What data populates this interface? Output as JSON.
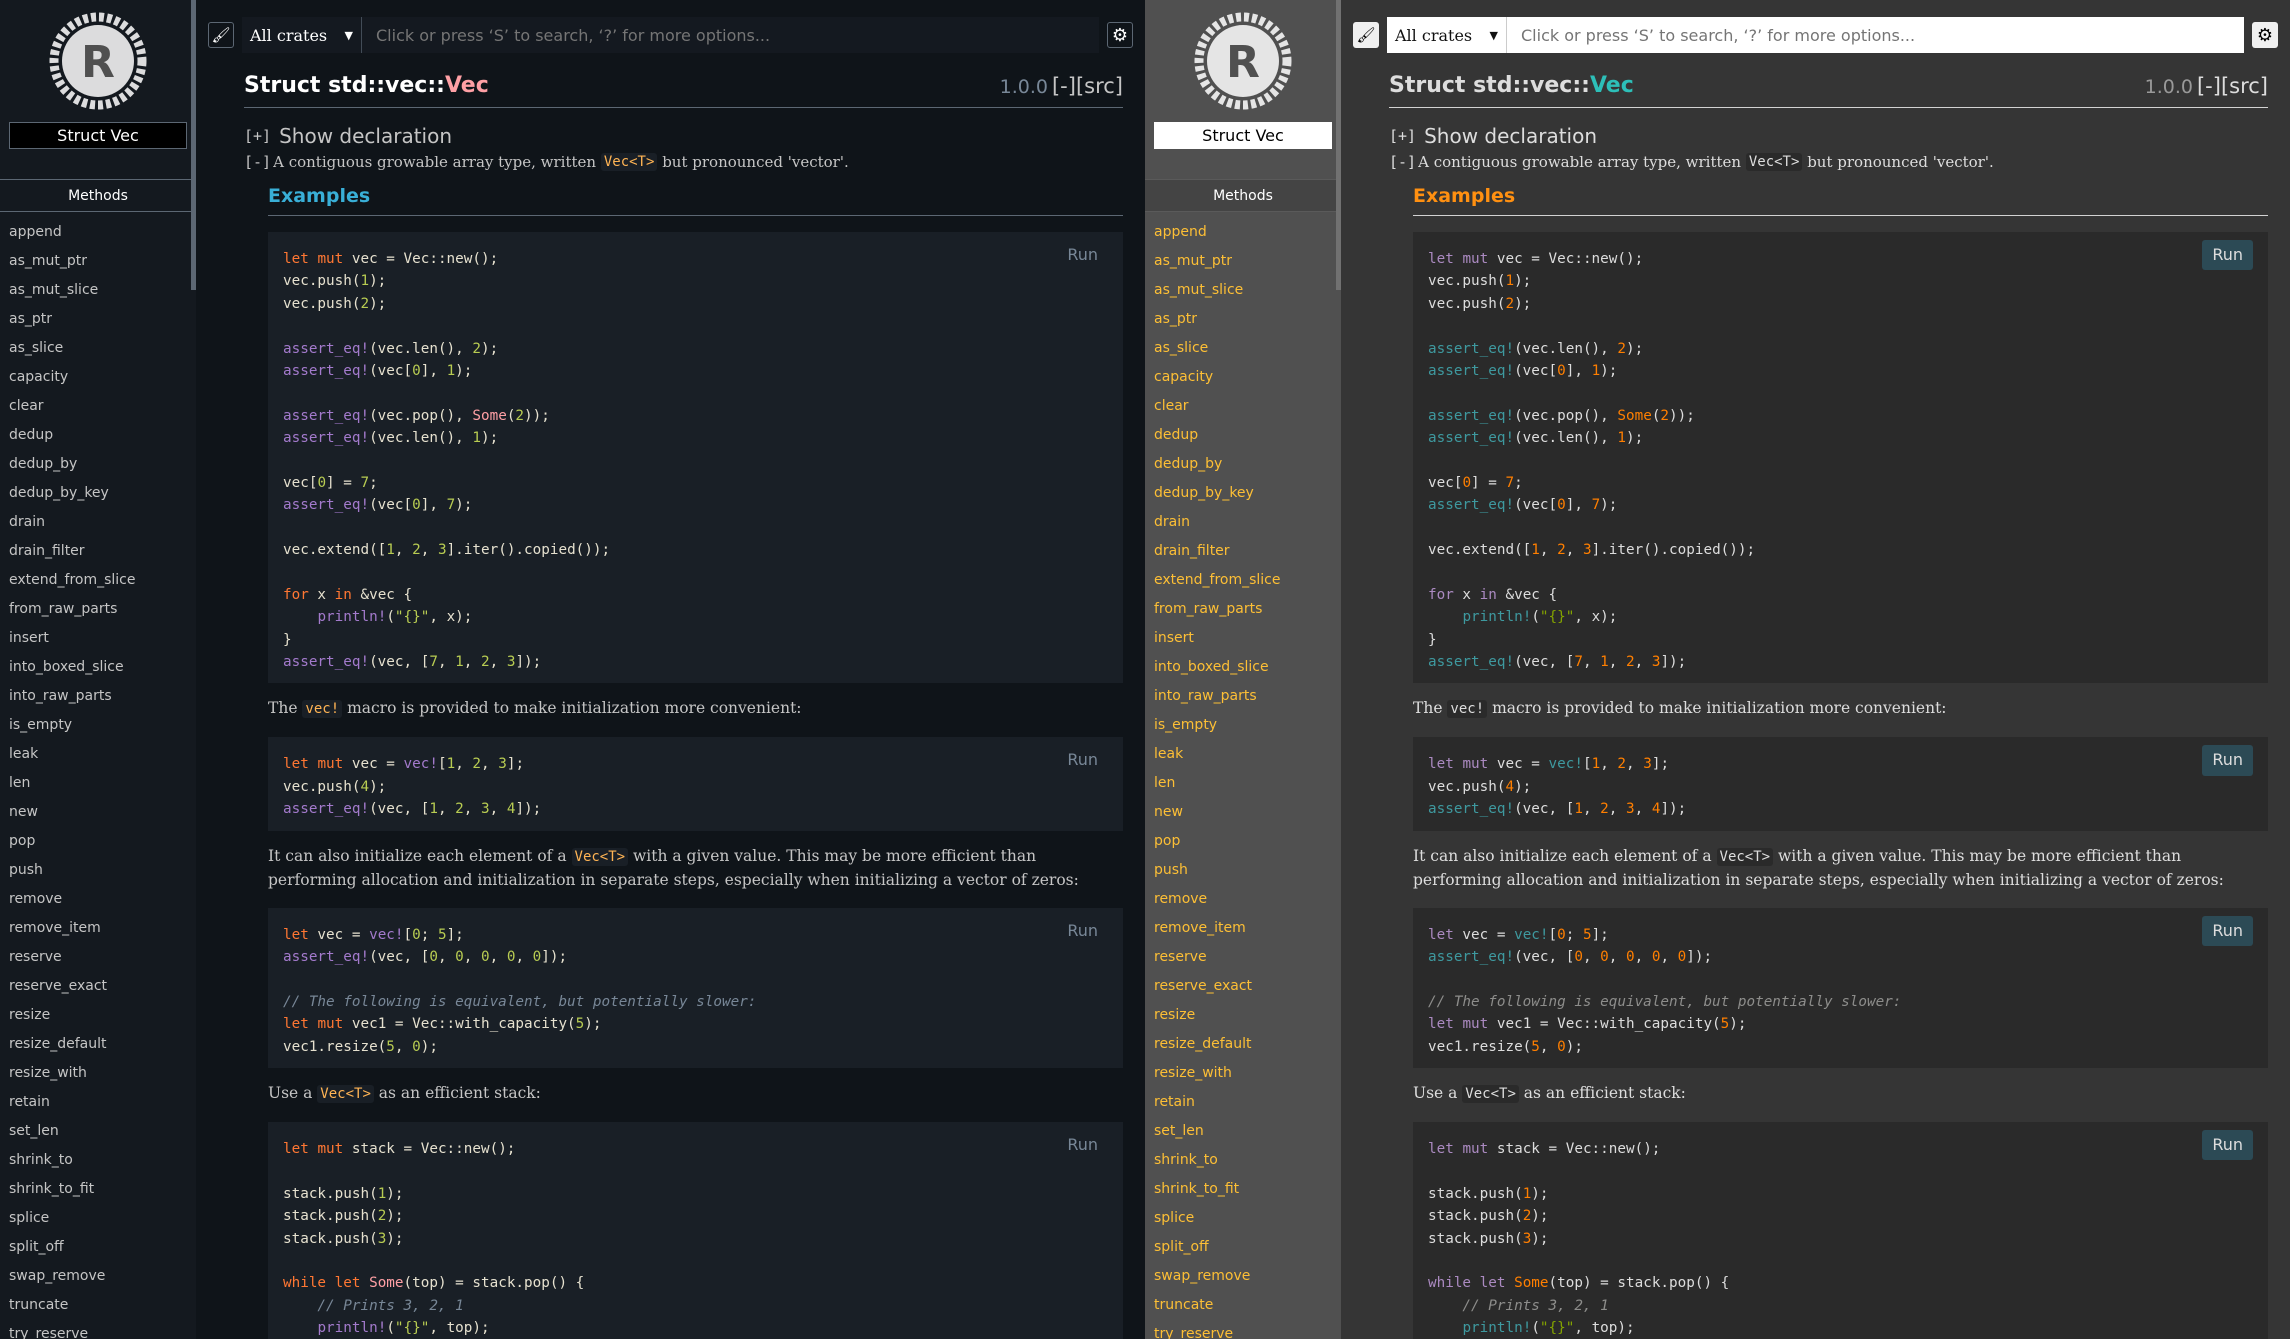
{
  "sidebar": {
    "struct_name": "Struct Vec",
    "methods_title": "Methods",
    "methods": [
      "append",
      "as_mut_ptr",
      "as_mut_slice",
      "as_ptr",
      "as_slice",
      "capacity",
      "clear",
      "dedup",
      "dedup_by",
      "dedup_by_key",
      "drain",
      "drain_filter",
      "extend_from_slice",
      "from_raw_parts",
      "insert",
      "into_boxed_slice",
      "into_raw_parts",
      "is_empty",
      "leak",
      "len",
      "new",
      "pop",
      "push",
      "remove",
      "remove_item",
      "reserve",
      "reserve_exact",
      "resize",
      "resize_default",
      "resize_with",
      "retain",
      "set_len",
      "shrink_to",
      "shrink_to_fit",
      "splice",
      "split_off",
      "swap_remove",
      "truncate",
      "try_reserve"
    ]
  },
  "topbar": {
    "theme_icon": "paintbrush-icon",
    "crate_select": "All crates",
    "search_placeholder": "Click or press ‘S’ to search, ‘?’ for more options...",
    "settings_icon": "gear-icon"
  },
  "header": {
    "title_prefix": "Struct std::vec::",
    "title_name": "Vec",
    "version": "1.0.0",
    "collapse": "[-]",
    "src": "[src]"
  },
  "declaration": {
    "toggle": "[+]",
    "label": "Show declaration"
  },
  "summary": {
    "toggle": "[-]",
    "before": "A contiguous growable array type, written ",
    "code": "Vec<T>",
    "after": " but pronounced 'vector'."
  },
  "examples_heading": "Examples",
  "run_label": "Run",
  "paragraphs": {
    "p1_before": "The ",
    "p1_code": "vec!",
    "p1_after": " macro is provided to make initialization more convenient:",
    "p2_before": "It can also initialize each element of a ",
    "p2_code": "Vec<T>",
    "p2_after": " with a given value. This may be more efficient than performing allocation and initialization in separate steps, especially when initializing a vector of zeros:",
    "p3_before": "Use a ",
    "p3_code": "Vec<T>",
    "p3_after": " as an efficient stack:"
  },
  "code_blocks": [
    [
      "let mut vec = Vec::new();",
      "vec.push(1);",
      "vec.push(2);",
      "",
      "assert_eq!(vec.len(), 2);",
      "assert_eq!(vec[0], 1);",
      "",
      "assert_eq!(vec.pop(), Some(2));",
      "assert_eq!(vec.len(), 1);",
      "",
      "vec[0] = 7;",
      "assert_eq!(vec[0], 7);",
      "",
      "vec.extend([1, 2, 3].iter().copied());",
      "",
      "for x in &vec {",
      "    println!(\"{}\", x);",
      "}",
      "assert_eq!(vec, [7, 1, 2, 3]);"
    ],
    [
      "let mut vec = vec![1, 2, 3];",
      "vec.push(4);",
      "assert_eq!(vec, [1, 2, 3, 4]);"
    ],
    [
      "let vec = vec![0; 5];",
      "assert_eq!(vec, [0, 0, 0, 0, 0]);",
      "",
      "// The following is equivalent, but potentially slower:",
      "let mut vec1 = Vec::with_capacity(5);",
      "vec1.resize(5, 0);"
    ],
    [
      "let mut stack = Vec::new();",
      "",
      "stack.push(1);",
      "stack.push(2);",
      "stack.push(3);",
      "",
      "while let Some(top) = stack.pop() {",
      "    // Prints 3, 2, 1",
      "    println!(\"{}\", top);",
      "}"
    ]
  ],
  "panels": [
    {
      "theme": "ayu",
      "name": "ayu-theme-panel"
    },
    {
      "theme": "dark",
      "name": "dark-theme-panel"
    }
  ]
}
